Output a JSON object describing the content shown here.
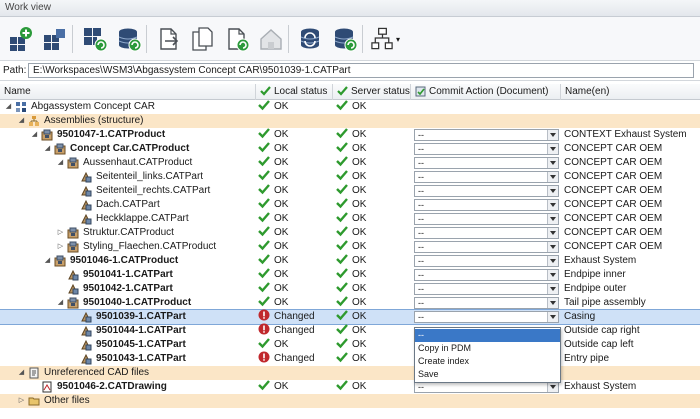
{
  "window": {
    "title": "Work view"
  },
  "path": {
    "label": "Path:",
    "value": "E:\\Workspaces\\WSM3\\Abgassystem Concept CAR\\9501039-1.CATPart"
  },
  "columns": [
    {
      "label": "Name"
    },
    {
      "label": "Local status",
      "icon": "check-icon"
    },
    {
      "label": "Server status",
      "icon": "check-icon"
    },
    {
      "label": "Commit Action (Document)",
      "icon": "commit-icon"
    },
    {
      "label": "Name(en)"
    }
  ],
  "toolbar": [
    {
      "icon": "add-document-icon"
    },
    {
      "icon": "add-multiple-documents-icon"
    },
    {
      "icon": "grid-refresh-icon"
    },
    {
      "icon": "database-refresh-icon"
    },
    {
      "icon": "document-export-icon"
    },
    {
      "icon": "document-copy-icon"
    },
    {
      "icon": "document-refresh-icon"
    },
    {
      "icon": "home-icon"
    },
    {
      "icon": "database-sync-icon"
    },
    {
      "icon": "database-commit-icon"
    },
    {
      "icon": "hierarchy-icon"
    }
  ],
  "rows": [
    {
      "level": 0,
      "exp": "expanded",
      "icon": "product-root-icon",
      "name": "Abgassystem Concept CAR",
      "bold": false,
      "group": false,
      "local": "OK",
      "server": "OK",
      "combo": null,
      "name_en": ""
    },
    {
      "level": 1,
      "exp": "expanded",
      "icon": "assembly-folder-icon",
      "name": "Assemblies (structure)",
      "bold": false,
      "group": true,
      "local": null,
      "server": null,
      "combo": null,
      "name_en": ""
    },
    {
      "level": 2,
      "exp": "expanded",
      "icon": "product-icon",
      "name": "9501047-1.CATProduct",
      "bold": true,
      "group": false,
      "local": "OK",
      "server": "OK",
      "combo": "--",
      "name_en": "CONTEXT Exhaust System"
    },
    {
      "level": 3,
      "exp": "expanded",
      "icon": "product-icon",
      "name": "Concept Car.CATProduct",
      "bold": true,
      "group": false,
      "local": "OK",
      "server": "OK",
      "combo": "--",
      "name_en": "CONCEPT CAR OEM"
    },
    {
      "level": 4,
      "exp": "expanded",
      "icon": "product-icon",
      "name": "Aussenhaut.CATProduct",
      "bold": false,
      "group": false,
      "local": "OK",
      "server": "OK",
      "combo": "--",
      "name_en": "CONCEPT CAR OEM"
    },
    {
      "level": 5,
      "exp": "none",
      "icon": "part-icon",
      "name": "Seitenteil_links.CATPart",
      "bold": false,
      "group": false,
      "local": "OK",
      "server": "OK",
      "combo": "--",
      "name_en": "CONCEPT CAR OEM"
    },
    {
      "level": 5,
      "exp": "none",
      "icon": "part-icon",
      "name": "Seitenteil_rechts.CATPart",
      "bold": false,
      "group": false,
      "local": "OK",
      "server": "OK",
      "combo": "--",
      "name_en": "CONCEPT CAR OEM"
    },
    {
      "level": 5,
      "exp": "none",
      "icon": "part-icon",
      "name": "Dach.CATPart",
      "bold": false,
      "group": false,
      "local": "OK",
      "server": "OK",
      "combo": "--",
      "name_en": "CONCEPT CAR OEM"
    },
    {
      "level": 5,
      "exp": "none",
      "icon": "part-icon",
      "name": "Heckklappe.CATPart",
      "bold": false,
      "group": false,
      "local": "OK",
      "server": "OK",
      "combo": "--",
      "name_en": "CONCEPT CAR OEM"
    },
    {
      "level": 4,
      "exp": "collapsed",
      "icon": "product-icon",
      "name": "Struktur.CATProduct",
      "bold": false,
      "group": false,
      "local": "OK",
      "server": "OK",
      "combo": "--",
      "name_en": "CONCEPT CAR OEM"
    },
    {
      "level": 4,
      "exp": "collapsed",
      "icon": "product-icon",
      "name": "Styling_Flaechen.CATProduct",
      "bold": false,
      "group": false,
      "local": "OK",
      "server": "OK",
      "combo": "--",
      "name_en": "CONCEPT CAR OEM"
    },
    {
      "level": 3,
      "exp": "expanded",
      "icon": "product-icon",
      "name": "9501046-1.CATProduct",
      "bold": true,
      "group": false,
      "local": "OK",
      "server": "OK",
      "combo": "--",
      "name_en": "Exhaust System"
    },
    {
      "level": 4,
      "exp": "none",
      "icon": "part-icon",
      "name": "9501041-1.CATPart",
      "bold": true,
      "group": false,
      "local": "OK",
      "server": "OK",
      "combo": "--",
      "name_en": "Endpipe inner"
    },
    {
      "level": 4,
      "exp": "none",
      "icon": "part-icon",
      "name": "9501042-1.CATPart",
      "bold": true,
      "group": false,
      "local": "OK",
      "server": "OK",
      "combo": "--",
      "name_en": "Endpipe outer"
    },
    {
      "level": 4,
      "exp": "expanded",
      "icon": "product-icon",
      "name": "9501040-1.CATProduct",
      "bold": true,
      "group": false,
      "local": "OK",
      "server": "OK",
      "combo": "--",
      "name_en": "Tail pipe assembly"
    },
    {
      "level": 5,
      "exp": "none",
      "icon": "part-icon",
      "name": "9501039-1.CATPart",
      "bold": true,
      "group": false,
      "selected": true,
      "local": "Changed",
      "server": "OK",
      "combo": "--",
      "name_en": "Casing"
    },
    {
      "level": 5,
      "exp": "none",
      "icon": "part-icon",
      "name": "9501044-1.CATPart",
      "bold": true,
      "group": false,
      "local": "Changed",
      "server": "OK",
      "combo": null,
      "name_en": "Outside cap right"
    },
    {
      "level": 5,
      "exp": "none",
      "icon": "part-icon",
      "name": "9501045-1.CATPart",
      "bold": true,
      "group": false,
      "local": "OK",
      "server": "OK",
      "combo": null,
      "name_en": "Outside cap left"
    },
    {
      "level": 5,
      "exp": "none",
      "icon": "part-icon",
      "name": "9501043-1.CATPart",
      "bold": true,
      "group": false,
      "local": "Changed",
      "server": "OK",
      "combo": null,
      "name_en": "Entry pipe"
    },
    {
      "level": 1,
      "exp": "expanded",
      "icon": "drawing-folder-icon",
      "name": "Unreferenced CAD files",
      "bold": false,
      "group": true,
      "local": null,
      "server": null,
      "combo": null,
      "name_en": ""
    },
    {
      "level": 2,
      "exp": "none",
      "icon": "drawing-icon",
      "name": "9501046-2.CATDrawing",
      "bold": true,
      "group": false,
      "local": "OK",
      "server": "OK",
      "combo": "--",
      "name_en": "Exhaust System"
    },
    {
      "level": 1,
      "exp": "collapsed",
      "icon": "other-folder-icon",
      "name": "Other files",
      "bold": false,
      "group": true,
      "local": null,
      "server": null,
      "combo": null,
      "name_en": ""
    }
  ],
  "dropdown": {
    "options": [
      "--",
      "Copy in PDM",
      "Create index",
      "Save"
    ],
    "highlighted": 0
  },
  "colors": {
    "ok": "#2e9a2e",
    "changed": "#c0282d",
    "group_bg": "#fbe6c7",
    "selection_bg": "#cfe1f7",
    "highlight": "#3a78c7"
  }
}
